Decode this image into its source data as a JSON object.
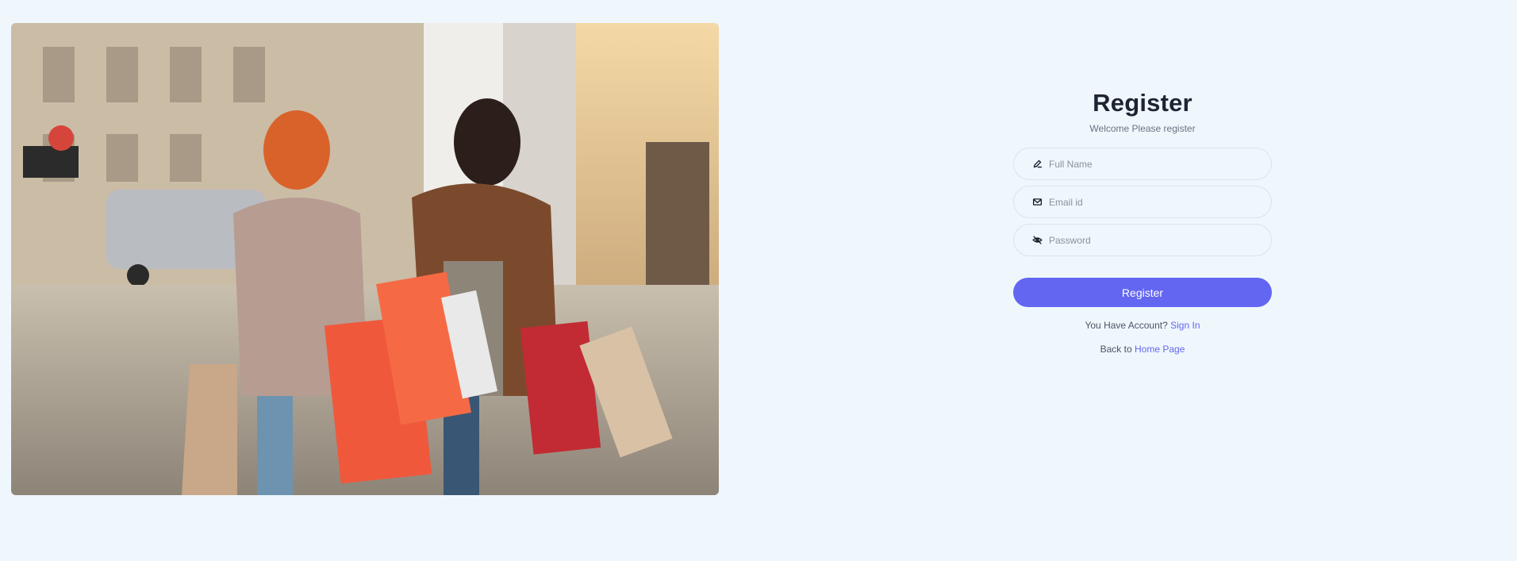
{
  "hero": {
    "image_alt": "Two women laughing and walking down a city street carrying shopping bags"
  },
  "form": {
    "title": "Register",
    "subtitle": "Welcome Please register",
    "fields": [
      {
        "name": "full_name",
        "placeholder": "Full Name",
        "value": "",
        "icon": "pen-icon"
      },
      {
        "name": "email",
        "placeholder": "Email id",
        "value": "",
        "icon": "mail-icon"
      },
      {
        "name": "password",
        "placeholder": "Password",
        "value": "",
        "icon": "eye-off-icon"
      }
    ],
    "submit_label": "Register",
    "account_prompt": "You Have Account?",
    "sign_in_link": "Sign In",
    "back_prompt": "Back to",
    "home_link": "Home Page"
  },
  "colors": {
    "background": "#eff7fd",
    "accent": "#6366f1",
    "title": "#1f2433"
  }
}
